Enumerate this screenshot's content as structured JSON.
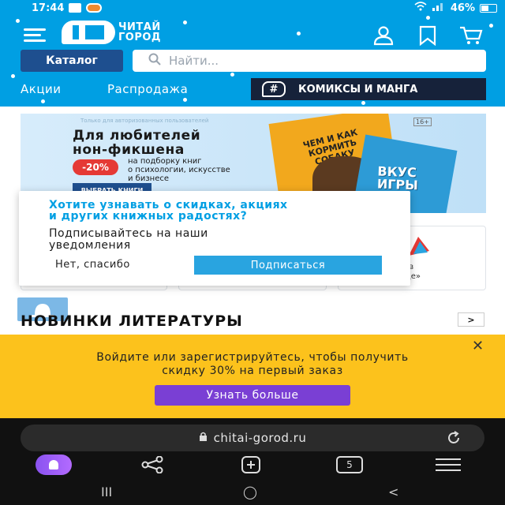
{
  "status": {
    "time": "17:44",
    "battery": "46%"
  },
  "header": {
    "logo_line1": "ЧИТАЙ",
    "logo_line2": "ГОРОД",
    "catalog_label": "Каталог",
    "search_placeholder": "Найти...",
    "nav": [
      "Акции",
      "Распродажа"
    ],
    "comics_label": "КОМИКСЫ И МАНГА",
    "comics_icon_text": "#"
  },
  "banner": {
    "note": "Только для авторизованных пользователей",
    "title_line1": "Для любителей",
    "title_line2": "нон-фикшена",
    "discount": "-20%",
    "subtitle_line1": "на подборку книг",
    "subtitle_line2": "о психологии, искусстве",
    "subtitle_line3": "и бизнесе",
    "cta": "ВЫБРАТЬ КНИГИ",
    "age": "16+",
    "book1_title": "ЧЕМ И КАК КОРМИТЬ СОБАКУ",
    "book2_title_line1": "ВКУС",
    "book2_title_line2": "ИГРЫ"
  },
  "card": {
    "text_line1": "ивно в",
    "text_line2": "городе»"
  },
  "popup": {
    "heading_line1": "Хотите узнавать о скидках, акциях",
    "heading_line2": "и других книжных радостях?",
    "body_line1": "Подписывайтесь на наши",
    "body_line2": "уведомления",
    "decline": "Нет, спасибо",
    "accept": "Подписаться"
  },
  "section": {
    "title": "НОВИНКИ ЛИТЕРАТУРЫ",
    "arrow": ">"
  },
  "promo": {
    "line1": "Войдите или зарегистрируйтесь, чтобы получить",
    "line2": "скидку 30% на первый заказ",
    "button": "Узнать больше",
    "close": "✕"
  },
  "browser": {
    "url": "chitai-gorod.ru",
    "tab_count": "5"
  },
  "sysnav": {
    "recent": "III",
    "home": "◯",
    "back": "<"
  }
}
